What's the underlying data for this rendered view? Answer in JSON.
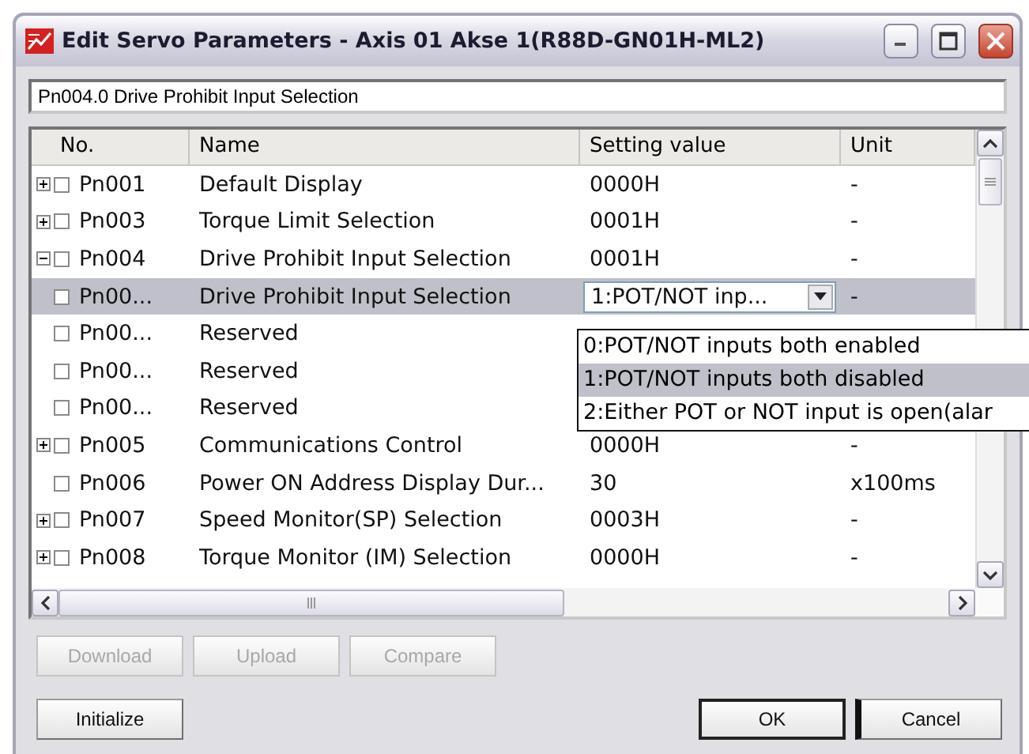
{
  "window": {
    "title": "Edit Servo Parameters - Axis 01 Akse 1(R88D-GN01H-ML2)"
  },
  "description": {
    "value": "Pn004.0 Drive Prohibit Input Selection"
  },
  "table": {
    "columns": [
      "No.",
      "Name",
      "Setting value",
      "Unit"
    ],
    "rows": [
      {
        "kind": "text",
        "expanded": false,
        "checked": false,
        "selected": false,
        "no": "Pn001",
        "name": "Default Display",
        "value": "0000H",
        "unit": "-"
      },
      {
        "kind": "text",
        "expanded": false,
        "checked": false,
        "selected": false,
        "no": "Pn003",
        "name": "Torque Limit Selection",
        "value": "0001H",
        "unit": "-"
      },
      {
        "kind": "text",
        "expanded": true,
        "checked": false,
        "selected": false,
        "no": "Pn004",
        "name": "Drive Prohibit Input Selection",
        "value": "0001H",
        "unit": "-",
        "children": [
          {
            "kind": "combo",
            "checked": false,
            "selected": true,
            "no": "Pn00...",
            "name": "Drive Prohibit Input Selection",
            "value": "1:POT/NOT inp...",
            "unit": "-"
          },
          {
            "kind": "text",
            "checked": false,
            "selected": false,
            "no": "Pn00...",
            "name": "Reserved"
          },
          {
            "kind": "text",
            "checked": false,
            "selected": false,
            "no": "Pn00...",
            "name": "Reserved"
          },
          {
            "kind": "text",
            "checked": false,
            "selected": false,
            "no": "Pn00...",
            "name": "Reserved"
          }
        ]
      },
      {
        "kind": "text",
        "expanded": false,
        "checked": false,
        "selected": false,
        "no": "Pn005",
        "name": "Communications Control",
        "value": "0000H",
        "unit": "-"
      },
      {
        "kind": "text",
        "checked": false,
        "selected": false,
        "no": "Pn006",
        "name": "Power ON Address Display Dur...",
        "value": "30",
        "unit": "x100ms"
      },
      {
        "kind": "text",
        "expanded": false,
        "checked": false,
        "selected": false,
        "no": "Pn007",
        "name": "Speed Monitor(SP) Selection",
        "value": "0003H",
        "unit": "-"
      },
      {
        "kind": "text",
        "expanded": false,
        "checked": false,
        "selected": false,
        "no": "Pn008",
        "name": "Torque Monitor (IM) Selection",
        "value": "0000H",
        "unit": "-"
      }
    ]
  },
  "dropdown": {
    "options": [
      {
        "label": "0:POT/NOT inputs both enabled",
        "selected": false
      },
      {
        "label": "1:POT/NOT inputs both disabled",
        "selected": true
      },
      {
        "label": "2:Either POT or NOT input is open(alar",
        "selected": false
      }
    ]
  },
  "transfer_buttons": [
    {
      "label": "Download",
      "disabled": true
    },
    {
      "label": "Upload",
      "disabled": true
    },
    {
      "label": "Compare",
      "disabled": true
    }
  ],
  "dialog_buttons": [
    {
      "label": "Initialize",
      "disabled": false,
      "default": false,
      "focused": false
    },
    {
      "label": "OK",
      "disabled": false,
      "default": true,
      "focused": false
    },
    {
      "label": "Cancel",
      "disabled": false,
      "default": false,
      "focused": true
    }
  ]
}
